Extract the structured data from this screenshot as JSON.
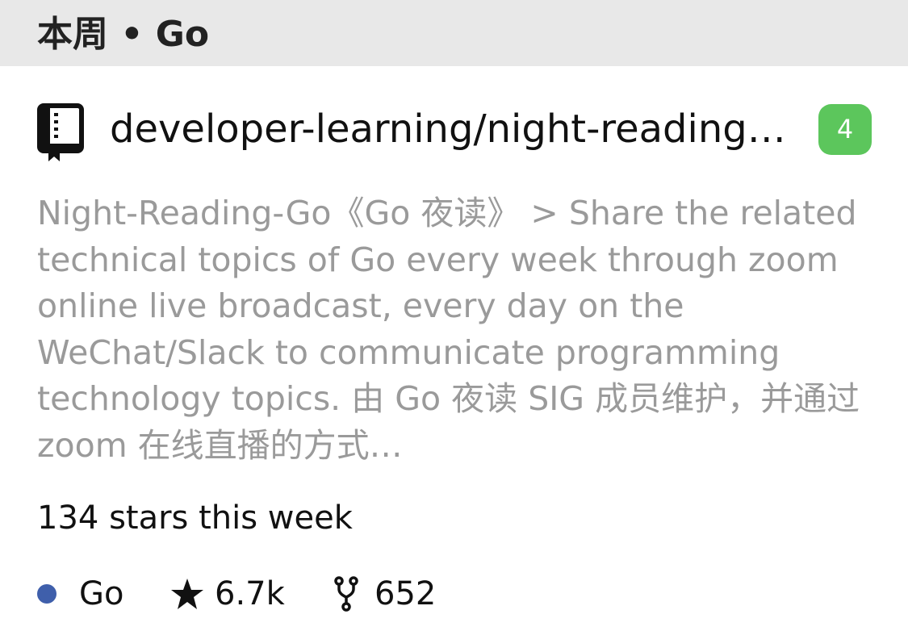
{
  "header": {
    "title": "本周 • Go"
  },
  "repo": {
    "icon": "repo-book-icon",
    "name": "developer-learning/night-reading-go",
    "rank": "4",
    "description": "Night-Reading-Go《Go 夜读》 > Share the related technical topics of Go every week through zoom online live broadcast, every day on the WeChat/Slack to communicate programming technology topics. 由 Go 夜读 SIG 成员维护，并通过 zoom 在线直播的方式…",
    "weekly_stars": "134 stars this week",
    "language": "Go",
    "language_color": "#3f5fab",
    "stars": "6.7k",
    "forks": "652"
  },
  "colors": {
    "badge": "#5cc65c",
    "header_bg": "#e8e8e8"
  }
}
